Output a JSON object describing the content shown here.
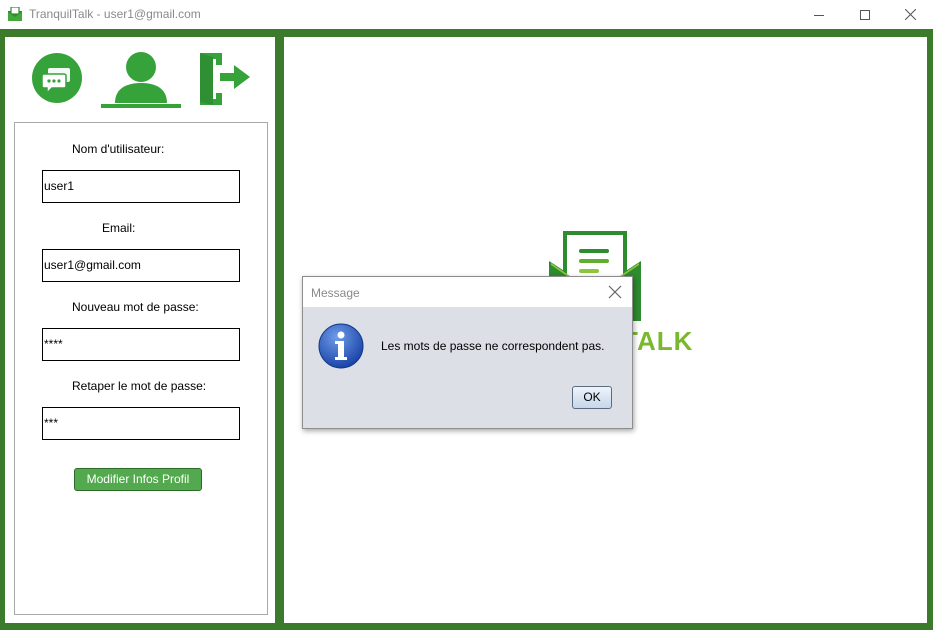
{
  "window": {
    "title": "TranquilTalk - user1@gmail.com",
    "controls": [
      "minimize",
      "maximize",
      "close"
    ]
  },
  "colors": {
    "frame": "#3c7a2c",
    "accent": "#36a33a",
    "button": "#53a94d",
    "dialog_bg": "#dcdfe6"
  },
  "nav": {
    "items": [
      {
        "icon": "chat-bubbles-icon",
        "active": false
      },
      {
        "icon": "user-profile-icon",
        "active": true
      },
      {
        "icon": "logout-icon",
        "active": false
      }
    ]
  },
  "profile": {
    "username_label": "Nom d'utilisateur:",
    "username_value": "user1",
    "email_label": "Email:",
    "email_value": "user1@gmail.com",
    "new_password_label": "Nouveau mot de passe:",
    "new_password_value": "****",
    "retype_password_label": "Retaper le mot de passe:",
    "retype_password_value": "***",
    "submit_label": "Modifier Infos Profil"
  },
  "main": {
    "logo_text_visible": "TALK",
    "logo_icon": "envelope-document-icon"
  },
  "dialog": {
    "title": "Message",
    "icon": "info-icon",
    "message": "Les mots de passe ne correspondent pas.",
    "ok_label": "OK"
  }
}
